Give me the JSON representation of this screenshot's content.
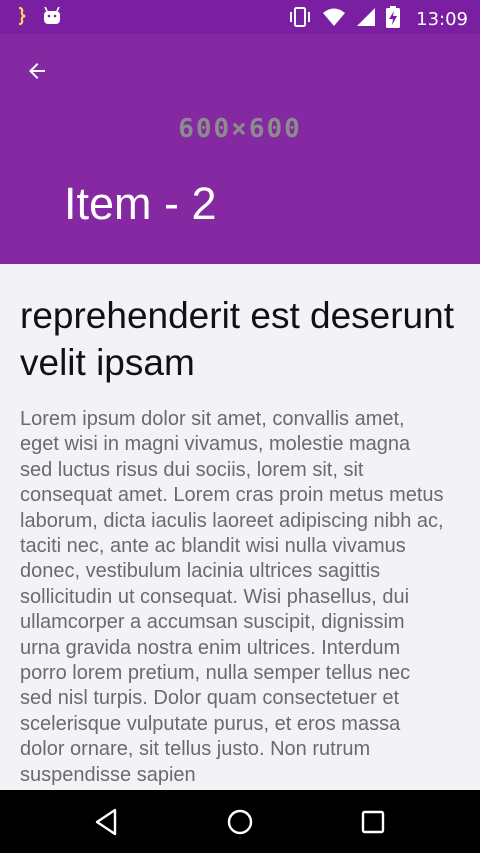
{
  "status_bar": {
    "time": "13:09",
    "left_icons": [
      "code-notification-icon",
      "android-notification-icon"
    ],
    "right_icons": [
      "vibrate-icon",
      "wifi-icon",
      "cell-signal-icon",
      "battery-charging-icon"
    ]
  },
  "app_bar": {
    "image_placeholder": "600×600",
    "title": "Item - 2",
    "background_color": "#8529a2"
  },
  "content": {
    "heading": "reprehenderit est deserunt velit ipsam",
    "body": "Lorem ipsum dolor sit amet, convallis amet, eget wisi in magni vivamus, molestie magna sed luctus risus dui sociis, lorem sit, sit consequat amet. Lorem cras proin metus metus laborum, dicta iaculis laoreet adipiscing nibh ac, taciti nec, ante ac blandit wisi nulla vivamus donec, vestibulum lacinia ultrices sagittis sollicitudin ut consequat. Wisi phasellus, dui ullamcorper a accumsan suscipit, dignissim urna gravida nostra enim ultrices. Interdum porro lorem pretium, nulla semper tellus nec sed nisl turpis. Dolor quam consectetuer et scelerisque vulputate purus, et eros massa dolor ornare, sit tellus justo. Non rutrum suspendisse sapien"
  },
  "nav_bar": {
    "buttons": [
      "back-triangle-icon",
      "home-circle-icon",
      "recents-square-icon"
    ]
  }
}
